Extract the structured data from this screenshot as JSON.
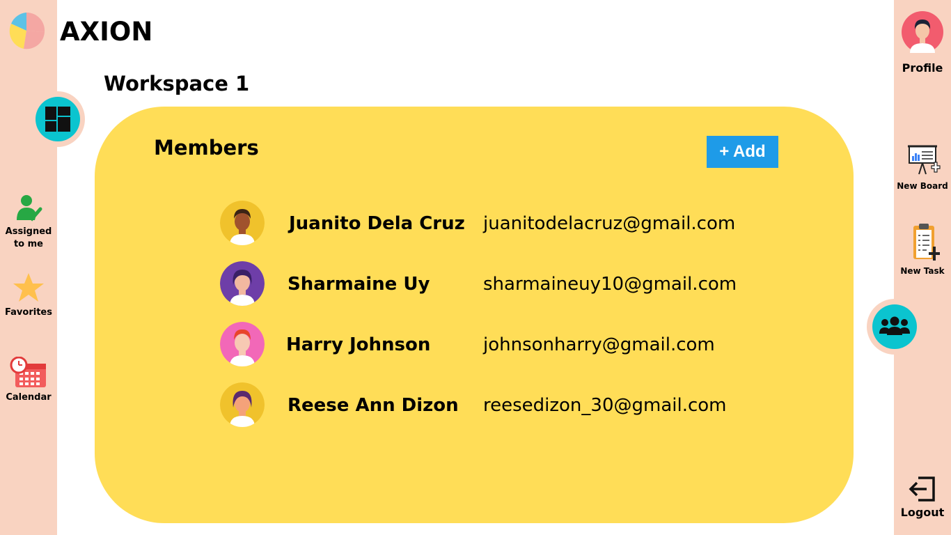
{
  "app": {
    "brand": "AXION"
  },
  "workspace": {
    "title": "Workspace 1"
  },
  "left_nav": {
    "items": [
      {
        "label_line1": "Assigned",
        "label_line2": "to me",
        "icon": "assigned-user-icon"
      },
      {
        "label_line1": "Favorites",
        "label_line2": "",
        "icon": "star-icon"
      },
      {
        "label_line1": "Calendar",
        "label_line2": "",
        "icon": "calendar-icon"
      }
    ]
  },
  "right_nav": {
    "profile": "Profile",
    "new_board": "New Board",
    "new_task": "New Task",
    "logout": "Logout"
  },
  "members": {
    "title": "Members",
    "add_label": "+ Add",
    "list": [
      {
        "name": "Juanito Dela Cruz",
        "email": "juanitodelacruz@gmail.com",
        "avatar_bg": "#f0c22c",
        "hair": "#3b2416",
        "skin": "#a0522d"
      },
      {
        "name": "Sharmaine Uy",
        "email": "sharmaineuy10@gmail.com",
        "avatar_bg": "#6e3ea8",
        "hair": "#3a1f66",
        "skin": "#f2b8a0"
      },
      {
        "name": "Harry Johnson",
        "email": "johnsonharry@gmail.com",
        "avatar_bg": "#f268b8",
        "hair": "#e8442a",
        "skin": "#f7c9b3"
      },
      {
        "name": "Reese Ann Dizon",
        "email": "reesedizon_30@gmail.com",
        "avatar_bg": "#f0c22c",
        "hair": "#5a2a6e",
        "skin": "#f4a27a"
      }
    ]
  },
  "colors": {
    "sidebar": "#f9d3c1",
    "card": "#ffdd57",
    "accent_teal": "#0bc4cf",
    "add_button": "#1e9be8"
  }
}
